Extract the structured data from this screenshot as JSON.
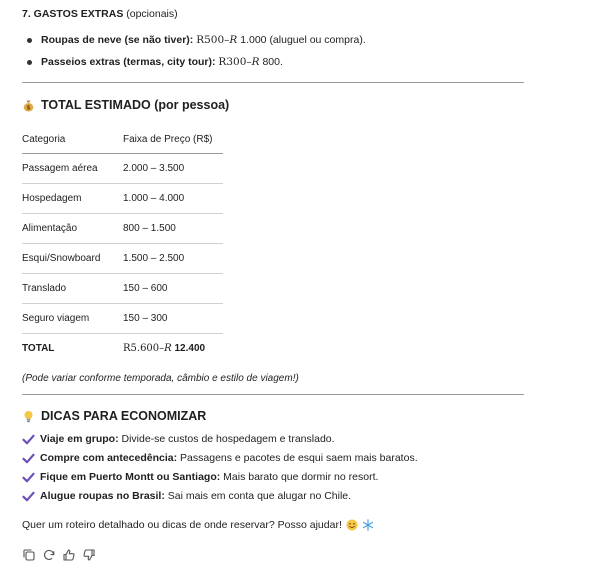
{
  "extras": {
    "heading_bold": "7. GASTOS EXTRAS",
    "heading_rest": " (opcionais)",
    "items": [
      {
        "label": "Roupas de neve (se não tiver):",
        "math_a": "R",
        "math_b": "500–",
        "math_c": "R",
        "tail": " 1.000 (aluguel ou compra)."
      },
      {
        "label": "Passeios extras (termas, city tour):",
        "math_a": "R",
        "math_b": "300–",
        "math_c": "R",
        "tail": " 800."
      }
    ]
  },
  "total": {
    "heading": "TOTAL ESTIMADO (por pessoa)",
    "icon": "money-bag-icon",
    "columns": [
      "Categoria",
      "Faixa de Preço (R$)"
    ],
    "rows": [
      [
        "Passagem aérea",
        "2.000 – 3.500"
      ],
      [
        "Hospedagem",
        "1.000 – 4.000"
      ],
      [
        "Alimentação",
        "800 – 1.500"
      ],
      [
        "Esqui/Snowboard",
        "1.500 – 2.500"
      ],
      [
        "Translado",
        "150 – 600"
      ],
      [
        "Seguro viagem",
        "150 – 300"
      ]
    ],
    "total_row": {
      "label": "TOTAL",
      "math_a": "R",
      "math_b": "5.600–",
      "math_c": "R",
      "tail": " 12.400"
    },
    "note": "(Pode variar conforme temporada, câmbio e estilo de viagem!)"
  },
  "tips": {
    "heading": "DICAS PARA ECONOMIZAR",
    "icon": "lightbulb-icon",
    "items": [
      {
        "bold": "Viaje em grupo:",
        "rest": " Divide-se custos de hospedagem e translado."
      },
      {
        "bold": "Compre com antecedência:",
        "rest": " Passagens e pacotes de esqui saem mais baratos."
      },
      {
        "bold": "Fique em Puerto Montt ou Santiago:",
        "rest": " Mais barato que dormir no resort."
      },
      {
        "bold": "Alugue roupas no Brasil:",
        "rest": " Sai mais em conta que alugar no Chile."
      }
    ]
  },
  "question": "Quer um roteiro detalhado ou dicas de onde reservar? Posso ajudar!",
  "question_icons": [
    "smiley-icon",
    "snowflake-icon"
  ],
  "actions": [
    "copy-icon",
    "regenerate-icon",
    "thumbs-up-icon",
    "thumbs-down-icon"
  ],
  "colors": {
    "text": "#1f1f1f",
    "check": "#6b4fbb",
    "rule": "#9a9a9a"
  }
}
